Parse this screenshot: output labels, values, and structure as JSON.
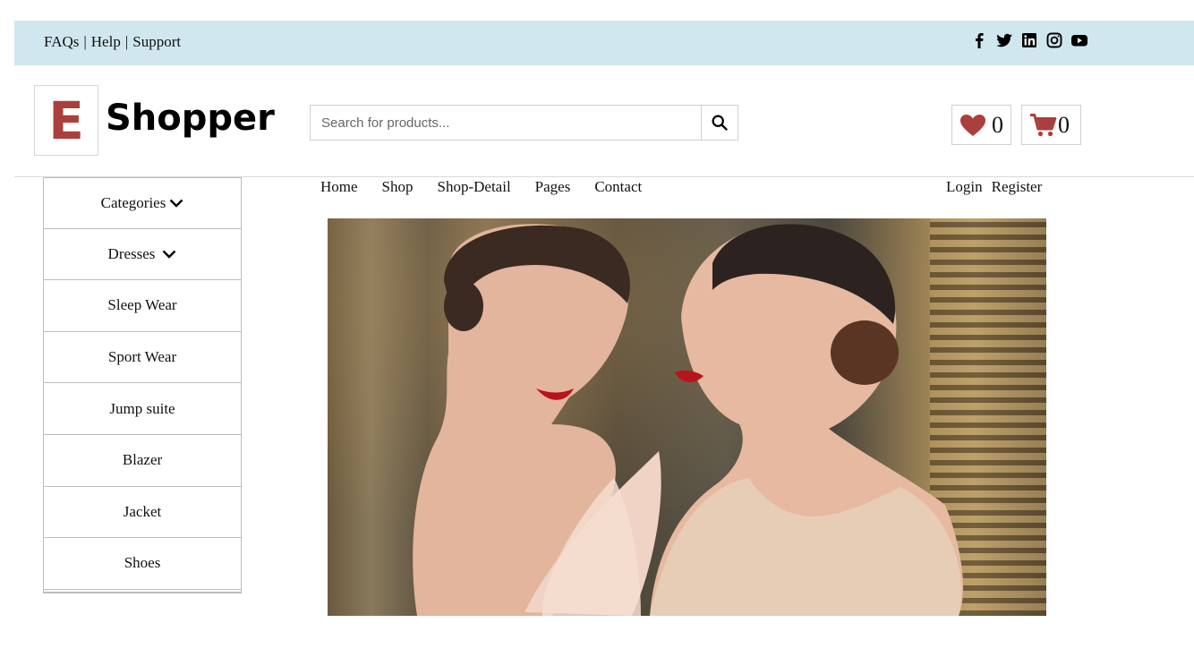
{
  "topbar": {
    "links": [
      "FAQs",
      "Help",
      "Support"
    ],
    "separator": "|",
    "social_icons": [
      "facebook-icon",
      "twitter-icon",
      "linkedin-icon",
      "instagram-icon",
      "youtube-icon"
    ]
  },
  "header": {
    "logo_letter": "E",
    "logo_text": "Shopper",
    "search_placeholder": "Search for products...",
    "search_value": "",
    "wishlist_count": "0",
    "cart_count": "0"
  },
  "sidebar": {
    "items": [
      {
        "label": "Categories",
        "has_chevron": true
      },
      {
        "label": "Dresses",
        "has_chevron": true
      },
      {
        "label": "Sleep Wear"
      },
      {
        "label": "Sport Wear"
      },
      {
        "label": "Jump suite"
      },
      {
        "label": "Blazer"
      },
      {
        "label": "Jacket"
      },
      {
        "label": "Shoes"
      }
    ]
  },
  "nav": {
    "items": [
      "Home",
      "Shop",
      "Shop-Detail",
      "Pages",
      "Contact"
    ],
    "auth": [
      "Login",
      "Register"
    ]
  },
  "colors": {
    "topbar_bg": "#d0e7f0",
    "accent": "#a9403d"
  }
}
